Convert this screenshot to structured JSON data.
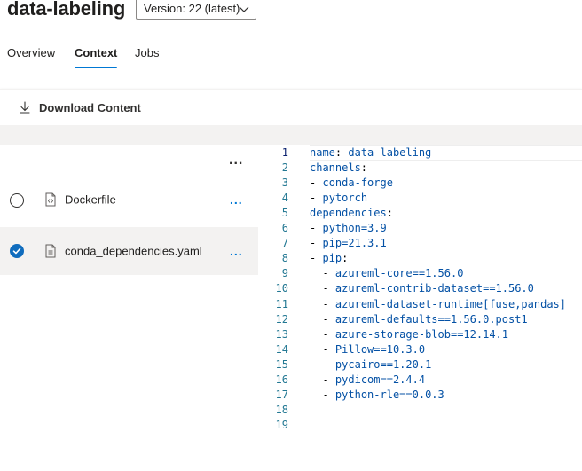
{
  "header": {
    "title": "data-labeling",
    "version_label": "Version: 22 (latest)"
  },
  "tabs": [
    {
      "label": "Overview",
      "active": false
    },
    {
      "label": "Context",
      "active": true
    },
    {
      "label": "Jobs",
      "active": false
    }
  ],
  "toolbar": {
    "download_label": "Download Content"
  },
  "file_panel": {
    "more_glyph": "...",
    "files": [
      {
        "name": "Dockerfile",
        "selected": false,
        "more_glyph": "..."
      },
      {
        "name": "conda_dependencies.yaml",
        "selected": true,
        "more_glyph": "..."
      }
    ]
  },
  "editor": {
    "current_line": 1,
    "lines": [
      {
        "no": "1",
        "text": "name: data-labeling"
      },
      {
        "no": "2",
        "text": "channels:"
      },
      {
        "no": "3",
        "text": "- conda-forge"
      },
      {
        "no": "4",
        "text": "- pytorch"
      },
      {
        "no": "5",
        "text": "dependencies:"
      },
      {
        "no": "6",
        "text": "- python=3.9"
      },
      {
        "no": "7",
        "text": "- pip=21.3.1"
      },
      {
        "no": "8",
        "text": "- pip:"
      },
      {
        "no": "9",
        "text": "  - azureml-core==1.56.0"
      },
      {
        "no": "10",
        "text": "  - azureml-contrib-dataset==1.56.0"
      },
      {
        "no": "11",
        "text": "  - azureml-dataset-runtime[fuse,pandas]"
      },
      {
        "no": "12",
        "text": "  - azureml-defaults==1.56.0.post1"
      },
      {
        "no": "13",
        "text": "  - azure-storage-blob==12.14.1"
      },
      {
        "no": "14",
        "text": "  - Pillow==10.3.0"
      },
      {
        "no": "15",
        "text": "  - pycairo==1.20.1"
      },
      {
        "no": "16",
        "text": "  - pydicom==2.4.4"
      },
      {
        "no": "17",
        "text": "  - python-rle==0.0.3"
      },
      {
        "no": "18",
        "text": ""
      },
      {
        "no": "19",
        "text": ""
      }
    ]
  },
  "colors": {
    "accent": "#0078d4",
    "yaml_key": "#0451a5",
    "line_number": "#237893",
    "selected_row": "#f3f2f1"
  }
}
